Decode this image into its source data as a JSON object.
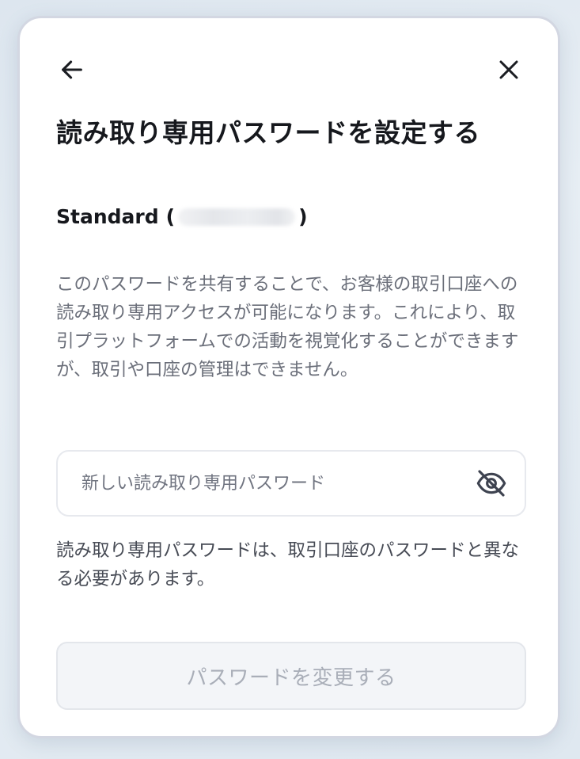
{
  "header": {
    "title": "読み取り専用パスワードを設定する",
    "back_icon": "arrow-left-icon",
    "close_icon": "close-icon"
  },
  "account": {
    "type": "Standard",
    "open_paren": "(",
    "close_paren": ")"
  },
  "description": "このパスワードを共有することで、お客様の取引口座への読み取り専用アクセスが可能になります。これにより、取引プラットフォームでの活動を視覚化することができますが、取引や口座の管理はできません。",
  "password_field": {
    "placeholder": "新しい読み取り専用パスワード",
    "value": "",
    "toggle_icon": "eye-off-icon"
  },
  "hint": "読み取り専用パスワードは、取引口座のパスワードと異なる必要があります。",
  "submit": {
    "label": "パスワードを変更する",
    "disabled": true
  },
  "colors": {
    "title_text": "#16181d",
    "body_text": "#6b6f7a",
    "hint_text": "#474b55",
    "disabled_button_bg": "#f3f5f8",
    "disabled_button_text": "#a9aeb8"
  }
}
